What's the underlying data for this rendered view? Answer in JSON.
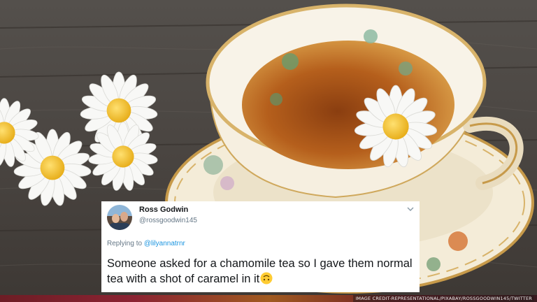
{
  "tweet": {
    "name": "Ross Godwin",
    "handle": "@rossgoodwin145",
    "reply_prefix": "Replying to",
    "reply_target": "@lilyannatrnr",
    "text": "Someone asked for a chamomile tea so I gave them normal tea with a shot of caramel in it",
    "emoji": "upside-down-face-emoji"
  },
  "credit": "IMAGE CREDIT-REPRESENTATIONAL/PIXABAY/ROSSGOODWIN145/TWITTER",
  "colors": {
    "wood": "#4a4440",
    "tea": "#c16a1e",
    "cup_rim": "#d8b36a",
    "daisy_center": "#f2c01d",
    "link": "#1b95e0"
  }
}
